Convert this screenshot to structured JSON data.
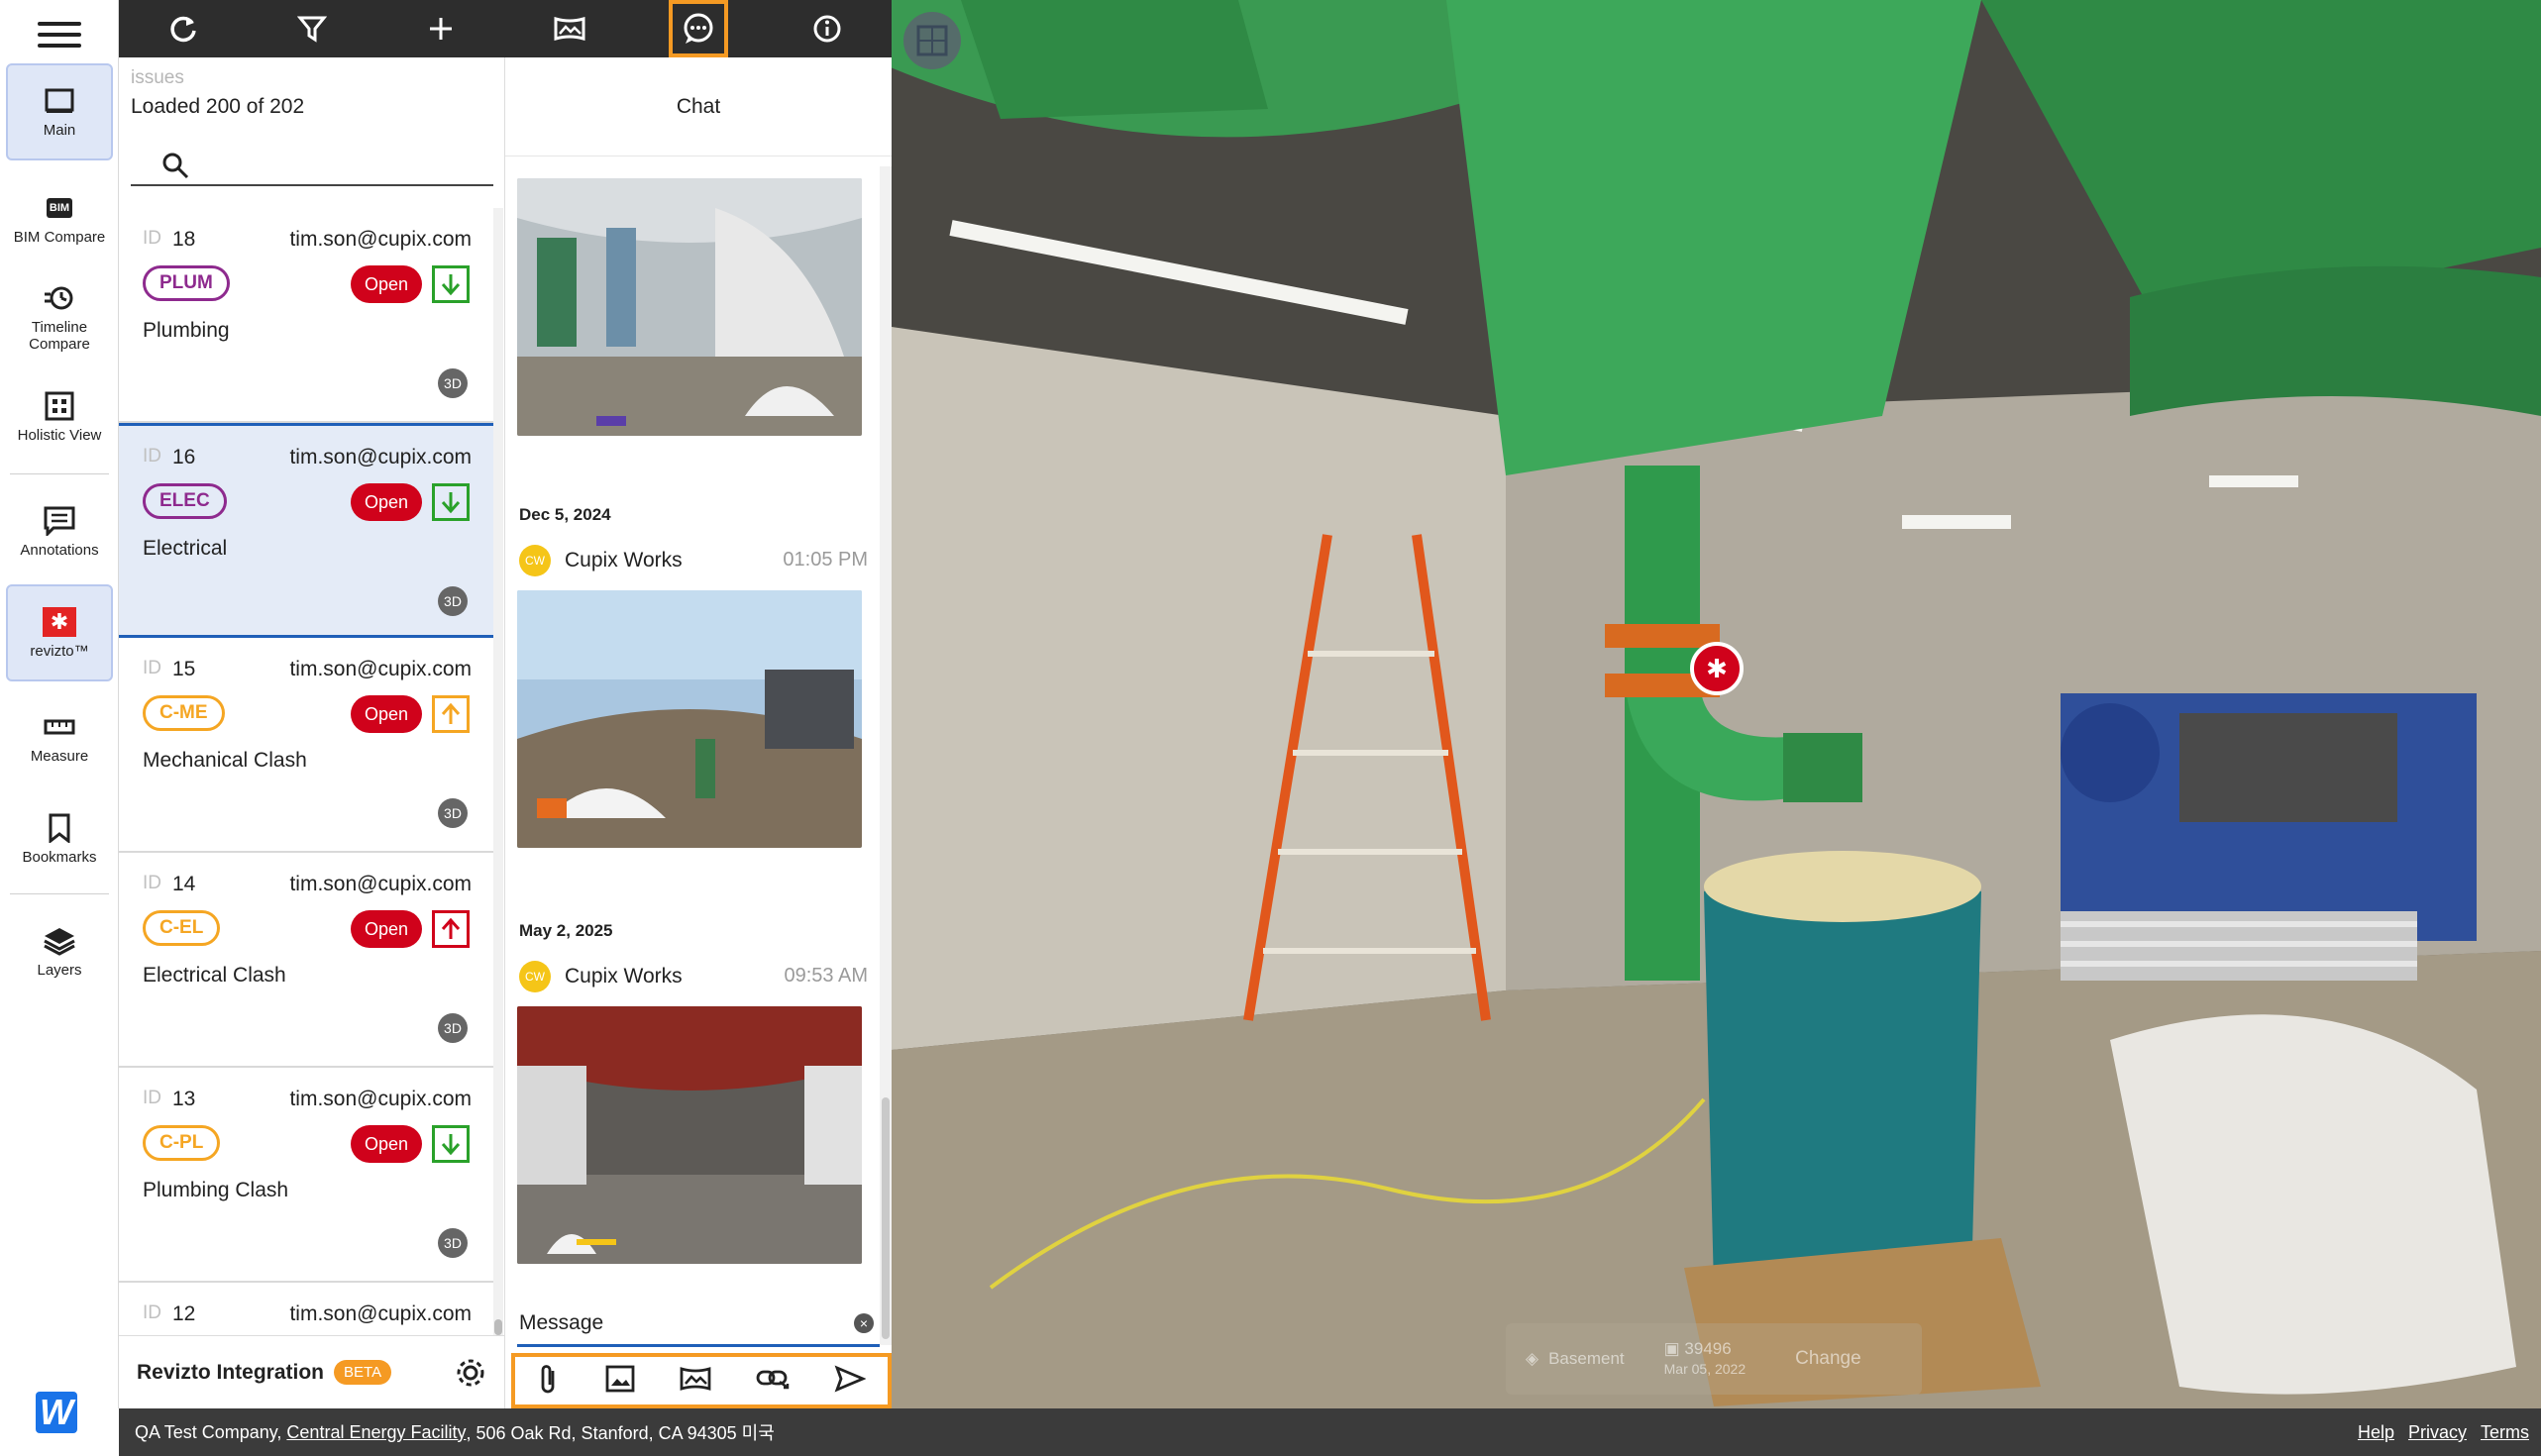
{
  "rail": {
    "items": [
      {
        "label": "Main",
        "icon": "main-view-icon"
      },
      {
        "label": "BIM Compare",
        "icon": "bim-icon"
      },
      {
        "label": "Timeline Compare",
        "icon": "timeline-icon"
      },
      {
        "label": "Holistic View",
        "icon": "holistic-grid-icon"
      },
      {
        "label": "Annotations",
        "icon": "annotations-icon"
      },
      {
        "label": "revizto™",
        "icon": "revizto-icon"
      },
      {
        "label": "Measure",
        "icon": "ruler-icon"
      },
      {
        "label": "Bookmarks",
        "icon": "bookmark-icon"
      },
      {
        "label": "Layers",
        "icon": "layers-icon"
      }
    ],
    "bim_badge": "BIM",
    "logo_letter": "W"
  },
  "toolbar": {
    "icons": [
      "refresh-icon",
      "filter-icon",
      "add-icon",
      "panorama-icon",
      "chat-icon",
      "info-icon"
    ]
  },
  "issues": {
    "section_label": "issues",
    "loaded_text": "Loaded 200 of 202",
    "id_label": "ID",
    "items": [
      {
        "id": "18",
        "email": "tim.son@cupix.com",
        "tag": "PLUM",
        "status": "Open",
        "title": "Plumbing",
        "badge": "3D",
        "priority": "down-green",
        "tag_color": "#8e2a8e"
      },
      {
        "id": "16",
        "email": "tim.son@cupix.com",
        "tag": "ELEC",
        "status": "Open",
        "title": "Electrical",
        "badge": "3D",
        "priority": "down-green",
        "tag_color": "#8e2a8e"
      },
      {
        "id": "15",
        "email": "tim.son@cupix.com",
        "tag": "C-ME",
        "status": "Open",
        "title": "Mechanical Clash",
        "badge": "3D",
        "priority": "up-orange",
        "tag_color": "#f5a623"
      },
      {
        "id": "14",
        "email": "tim.son@cupix.com",
        "tag": "C-EL",
        "status": "Open",
        "title": "Electrical Clash",
        "badge": "3D",
        "priority": "up-red",
        "tag_color": "#f5a623"
      },
      {
        "id": "13",
        "email": "tim.son@cupix.com",
        "tag": "C-PL",
        "status": "Open",
        "title": "Plumbing Clash",
        "badge": "3D",
        "priority": "down-green",
        "tag_color": "#f5a623"
      },
      {
        "id": "12",
        "email": "tim.son@cupix.com",
        "tag": "",
        "status": "",
        "title": "",
        "badge": "",
        "priority": "",
        "tag_color": "#f5a623"
      }
    ],
    "footer": {
      "label": "Revizto Integration",
      "beta": "BETA"
    }
  },
  "chat": {
    "title": "Chat",
    "messages": [
      {
        "date": "Dec 5, 2024",
        "avatar": "CW",
        "author": "Cupix Works",
        "time": "01:05 PM"
      },
      {
        "date": "May 2, 2025",
        "avatar": "CW",
        "author": "Cupix Works",
        "time": "09:53 AM"
      }
    ],
    "input_value": "Message",
    "actions": [
      "attach-icon",
      "image-icon",
      "panorama-icon",
      "link-icon",
      "send-icon"
    ]
  },
  "viewer": {
    "level": "Basement",
    "capture_id": "39496",
    "capture_date": "Mar 05, 2022",
    "change_label": "Change"
  },
  "statusbar": {
    "company": "QA Test Company,",
    "project": "Central Energy Facility",
    "address": ", 506 Oak Rd, Stanford, CA 94305 미국",
    "links": [
      "Help",
      "Privacy",
      "Terms"
    ]
  },
  "colors": {
    "accent_orange": "#f59a23",
    "status_red": "#d0021b",
    "selection_blue": "#1f5fb8",
    "toolbar_dark": "#2d2d2d"
  }
}
